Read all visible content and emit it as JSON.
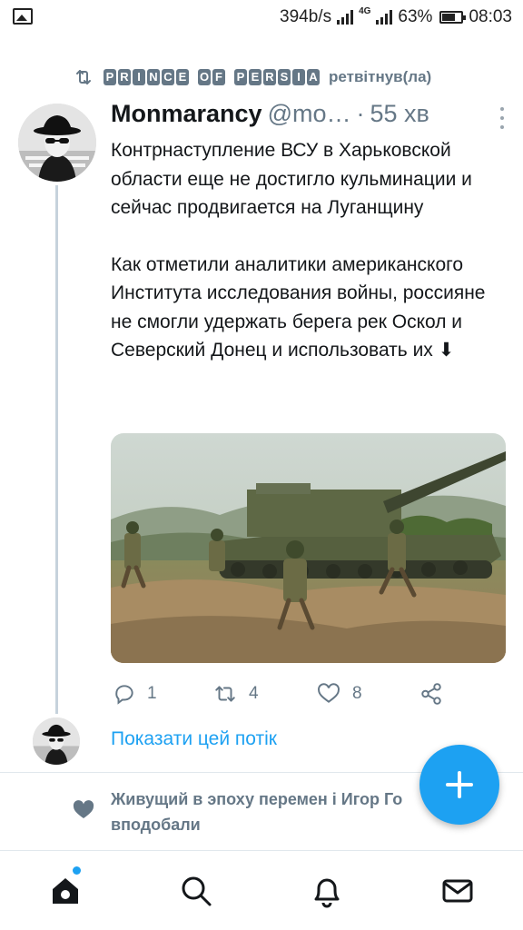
{
  "status_bar": {
    "net_speed": "394b/s",
    "network_type": "4G",
    "battery": "63%",
    "time": "08:03",
    "icons": [
      "gallery-icon",
      "signal-icon",
      "battery-icon"
    ]
  },
  "retweet": {
    "retweeter_words": [
      "PRINCE",
      "OF",
      "PERSIA"
    ],
    "action": "ретвітнув(ла)",
    "icon": "retweet-icon"
  },
  "tweet": {
    "display_name": "Monmarancy",
    "handle": "@mo…",
    "separator": "·",
    "time": "55 хв",
    "paragraph1": "Контрнаступление ВСУ в Харьковской области еще не достигло кульминации и сейчас продвигается на Луганщину",
    "paragraph2": "Как отметили аналитики американского Института исследования войны, россияне не смогли удержать берега рек Оскол и Северский Донец и использовать их ⬇",
    "actions": {
      "reply_count": "1",
      "retweet_count": "4",
      "like_count": "8"
    }
  },
  "show_thread": "Показати цей потік",
  "liked_by": {
    "names": "Живущий в эпоху перемен і Игор Го",
    "action": "вподобали",
    "icon": "heart-icon"
  },
  "nav": {
    "items": [
      "home-icon",
      "search-icon",
      "notifications-icon",
      "messages-icon"
    ]
  },
  "colors": {
    "accent": "#1da1f2",
    "secondary_text": "#657786",
    "primary_text": "#14171a"
  }
}
